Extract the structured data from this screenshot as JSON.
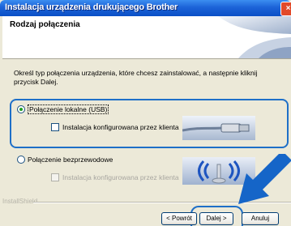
{
  "window": {
    "title": "Instalacja urządzenia drukującego Brother",
    "close_glyph": "×"
  },
  "header": {
    "title": "Rodzaj połączenia"
  },
  "description": "Określ typ połączenia urządzenia, które chcesz zainstalować, a następnie kliknij przycisk Dalej.",
  "options": {
    "local": {
      "label": "Połączenie lokalne (USB)",
      "selected": true,
      "custom_install": "Instalacja konfigurowana przez klienta"
    },
    "wireless": {
      "label": "Połączenie bezprzewodowe",
      "selected": false,
      "custom_install": "Instalacja konfigurowana przez klienta"
    }
  },
  "footer": {
    "brand": "InstallShield"
  },
  "buttons": {
    "back": "< Powrót",
    "next": "Dalej >",
    "cancel": "Anuluj"
  },
  "colors": {
    "highlight": "#1e6fc8",
    "titlebar": "#1c63d8",
    "dialog_bg": "#ece9d8"
  },
  "icons": [
    "close-icon",
    "usb-cable-icon",
    "wireless-signal-icon",
    "pointer-arrow-icon"
  ]
}
